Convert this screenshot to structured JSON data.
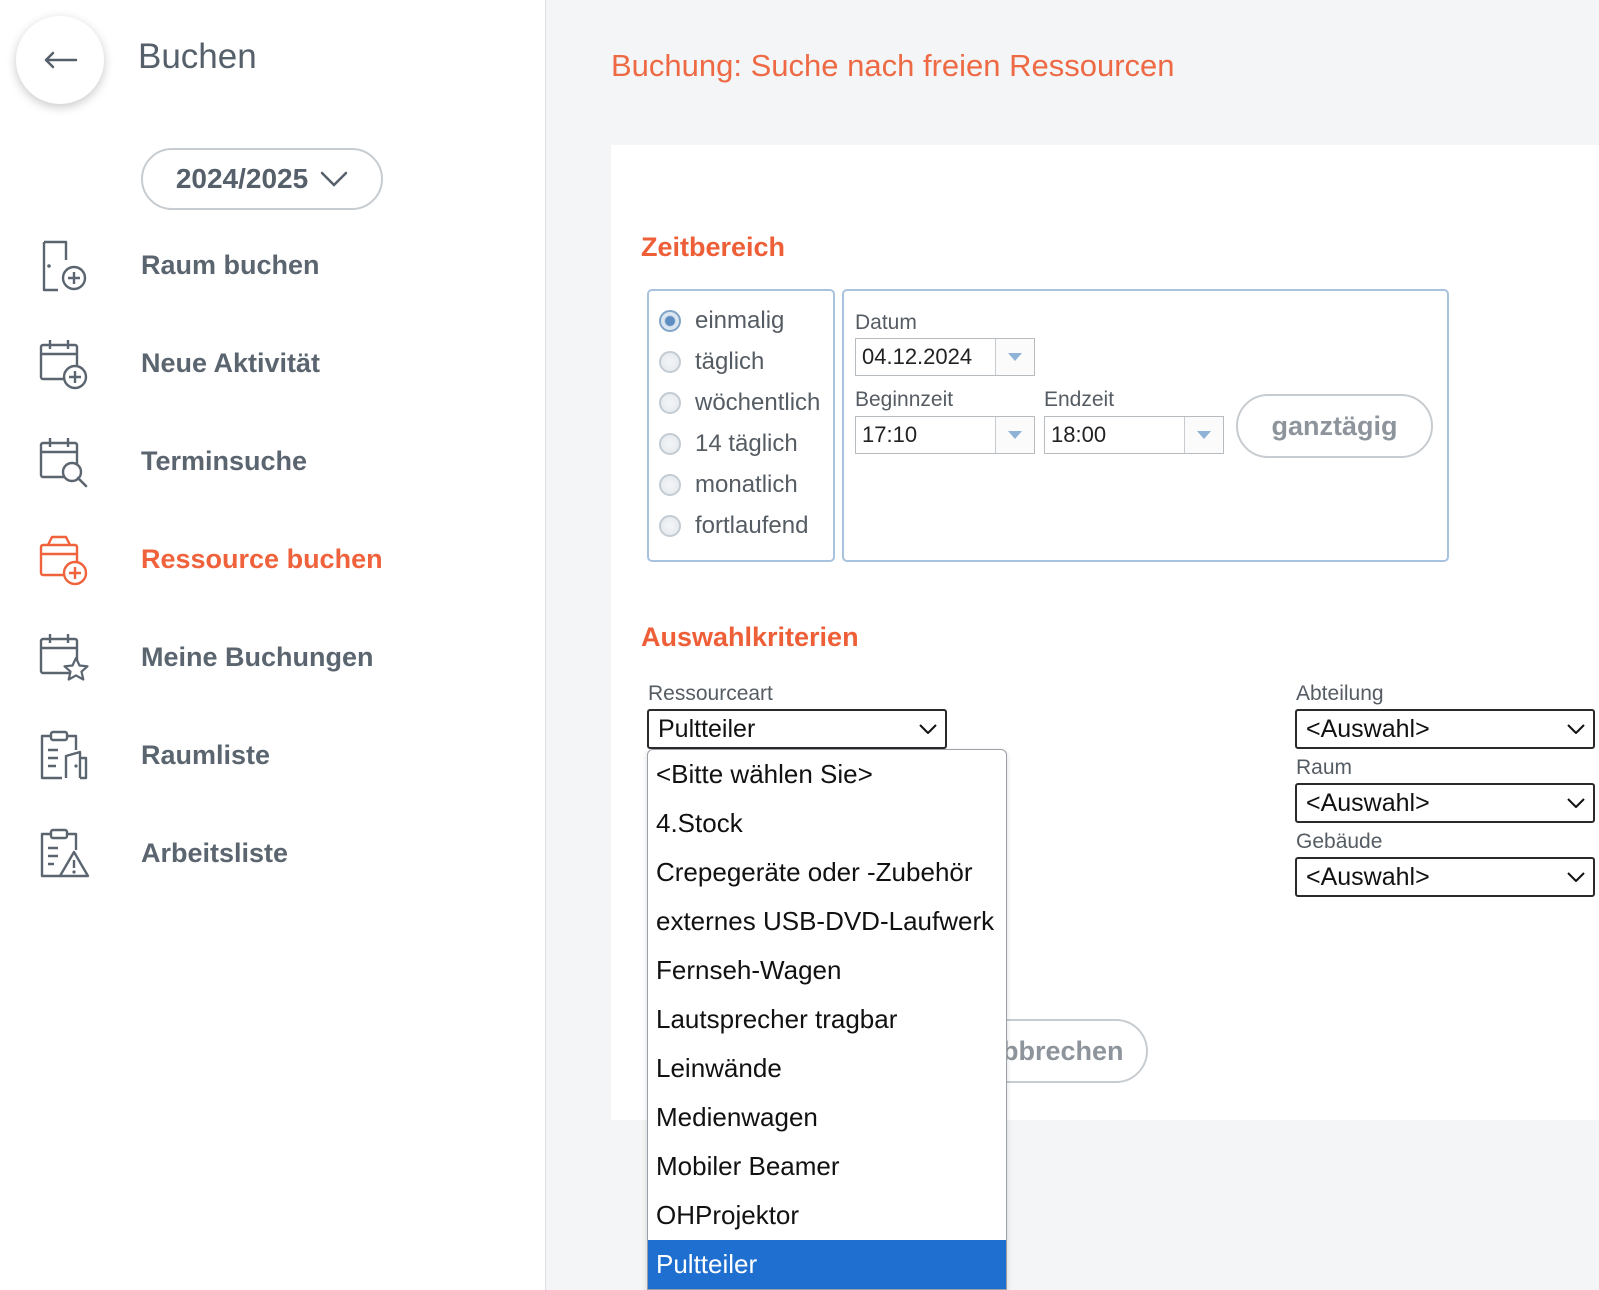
{
  "sidebar": {
    "title": "Buchen",
    "school_year": "2024/2025",
    "items": [
      {
        "label": "Raum buchen",
        "icon": "room-add-icon"
      },
      {
        "label": "Neue Aktivität",
        "icon": "calendar-add-icon"
      },
      {
        "label": "Terminsuche",
        "icon": "calendar-search-icon"
      },
      {
        "label": "Ressource buchen",
        "icon": "calendar-box-add-icon",
        "active": true
      },
      {
        "label": "Meine Buchungen",
        "icon": "calendar-star-icon"
      },
      {
        "label": "Raumliste",
        "icon": "clipboard-door-icon"
      },
      {
        "label": "Arbeitsliste",
        "icon": "clipboard-warning-icon"
      }
    ]
  },
  "main": {
    "heading": "Buchung: Suche nach freien Ressourcen",
    "zeitbereich": {
      "title": "Zeitbereich",
      "recurrence_options": [
        "einmalig",
        "täglich",
        "wöchentlich",
        "14 täglich",
        "monatlich",
        "fortlaufend"
      ],
      "recurrence_selected": "einmalig",
      "date_label": "Datum",
      "date_value": "04.12.2024",
      "start_label": "Beginnzeit",
      "start_value": "17:10",
      "end_label": "Endzeit",
      "end_value": "18:00",
      "allday_button": "ganztägig"
    },
    "auswahlkriterien": {
      "title": "Auswahlkriterien",
      "resource_type_label": "Ressourceart",
      "resource_type_value": "Pultteiler",
      "department_label": "Abteilung",
      "department_value": "<Auswahl>",
      "room_label": "Raum",
      "room_value": "<Auswahl>",
      "building_label": "Gebäude",
      "building_value": "<Auswahl>"
    },
    "cancel_button": "Abbrechen",
    "resource_type_options": [
      "<Bitte wählen Sie>",
      "4.Stock",
      "Crepegeräte oder -Zubehör",
      "externes USB-DVD-Laufwerk",
      "Fernseh-Wagen",
      "Lautsprecher tragbar",
      "Leinwände",
      "Medienwagen",
      "Mobiler Beamer",
      "OHProjektor",
      "Pultteiler"
    ],
    "resource_type_selected": "Pultteiler"
  },
  "colors": {
    "accent": "#ee6a45",
    "active_nav": "#f0623c",
    "selected_option": "#1f6fd0",
    "frame_border": "#a9c3df"
  }
}
